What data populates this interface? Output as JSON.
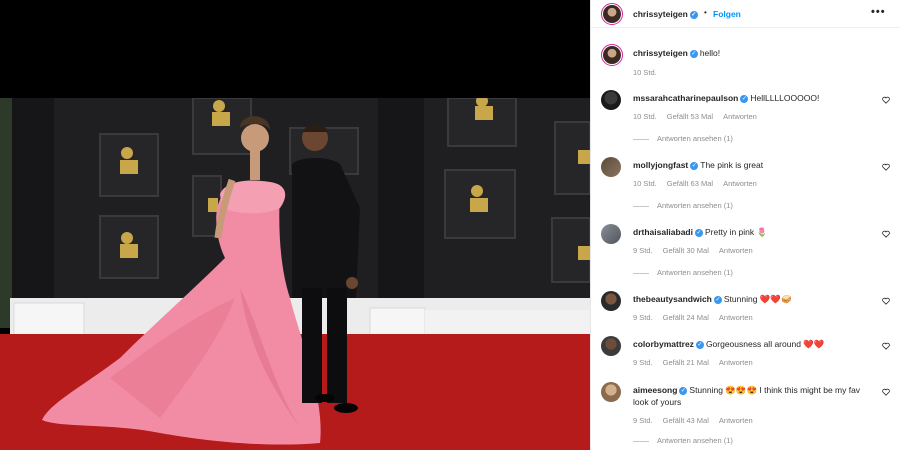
{
  "header": {
    "username": "chrissyteigen",
    "follow_label": "Folgen",
    "separator": "•",
    "more_label": "•••"
  },
  "caption": {
    "username": "chrissyteigen",
    "text": "hello!",
    "time": "10 Std."
  },
  "comments": [
    {
      "username": "mssarahcatharinepaulson",
      "verified": true,
      "text": "HellLLLLOOOOO!",
      "time": "10 Std.",
      "likes": "Gefällt 53 Mal",
      "reply": "Antworten",
      "view_replies": "Antworten ansehen (1)"
    },
    {
      "username": "mollyjongfast",
      "verified": true,
      "text": "The pink is great",
      "time": "10 Std.",
      "likes": "Gefällt 63 Mal",
      "reply": "Antworten",
      "view_replies": "Antworten ansehen (1)"
    },
    {
      "username": "drthaisaliabadi",
      "verified": true,
      "text": "Pretty in pink 🌷",
      "time": "9 Std.",
      "likes": "Gefällt 30 Mal",
      "reply": "Antworten",
      "view_replies": "Antworten ansehen (1)"
    },
    {
      "username": "thebeautysandwich",
      "verified": true,
      "text": "Stunning ❤️❤️🥪",
      "time": "9 Std.",
      "likes": "Gefällt 24 Mal",
      "reply": "Antworten",
      "view_replies": ""
    },
    {
      "username": "colorbymattrez",
      "verified": true,
      "text": "Gorgeousness all around ❤️❤️",
      "time": "9 Std.",
      "likes": "Gefällt 21 Mal",
      "reply": "Antworten",
      "view_replies": ""
    },
    {
      "username": "aimeesong",
      "verified": true,
      "text": "Stunning 😍😍😍 I think this might be my fav look of yours",
      "time": "9 Std.",
      "likes": "Gefällt 43 Mal",
      "reply": "Antworten",
      "view_replies": "Antworten ansehen (1)"
    }
  ],
  "colors": {
    "accent": "#0095f6",
    "verified": "#3897f0",
    "muted": "#8e8e8e"
  },
  "icons": {
    "more": "more-horizontal-icon",
    "heart": "heart-outline-icon",
    "verified": "verified-badge-icon"
  }
}
